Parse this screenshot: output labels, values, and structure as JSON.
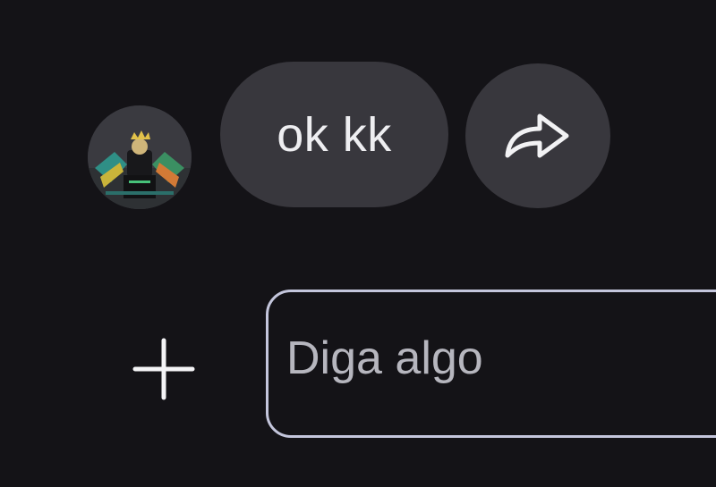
{
  "chat": {
    "message": {
      "text": "ok kk",
      "avatar_icon": "user-avatar-image"
    },
    "share_icon": "share-arrow-icon"
  },
  "composer": {
    "add_icon": "plus-icon",
    "placeholder": "Diga algo",
    "value": ""
  },
  "colors": {
    "background": "#141317",
    "bubble": "#38373d",
    "text": "#eeeef1",
    "placeholder": "#b6b6be",
    "input_border": "#c4c6dc"
  }
}
